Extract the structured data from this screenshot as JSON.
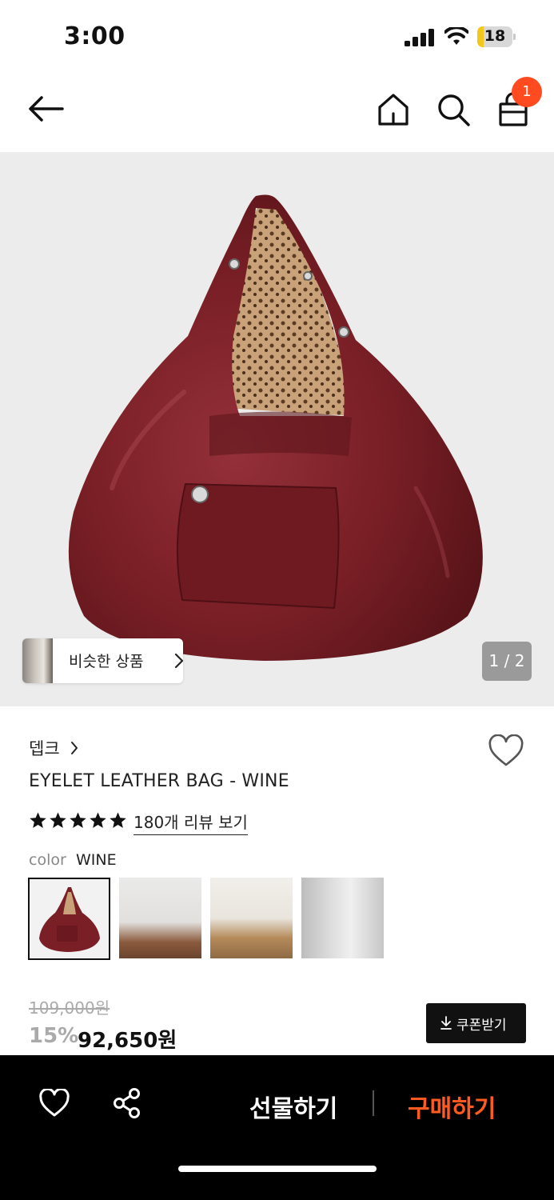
{
  "status_bar": {
    "time": "3:00",
    "battery": "18",
    "battery_level": 0.18
  },
  "nav": {
    "cart_count": "1",
    "icons": [
      "back-arrow-icon",
      "home-icon",
      "search-icon",
      "shopping-bag-icon"
    ]
  },
  "hero": {
    "similar_label": "비슷한 상품",
    "page_indicator": "1 / 2"
  },
  "product": {
    "brand": "뎁크",
    "title": "EYELET LEATHER BAG - WINE",
    "rating_stars": 5,
    "reviews_link": "180개 리뷰 보기",
    "color_label": "color",
    "color_value": "WINE",
    "original_price": "109,000원",
    "discount": "15%",
    "price": "92,650원",
    "coupon_label": "쿠폰받기"
  },
  "bottom_bar": {
    "gift_label": "선물하기",
    "buy_label": "구매하기"
  },
  "colors": {
    "accent": "#ff5a1f",
    "badge": "#ff4b1f",
    "bag": "#7a1f24",
    "bottom_bg": "#000000"
  }
}
